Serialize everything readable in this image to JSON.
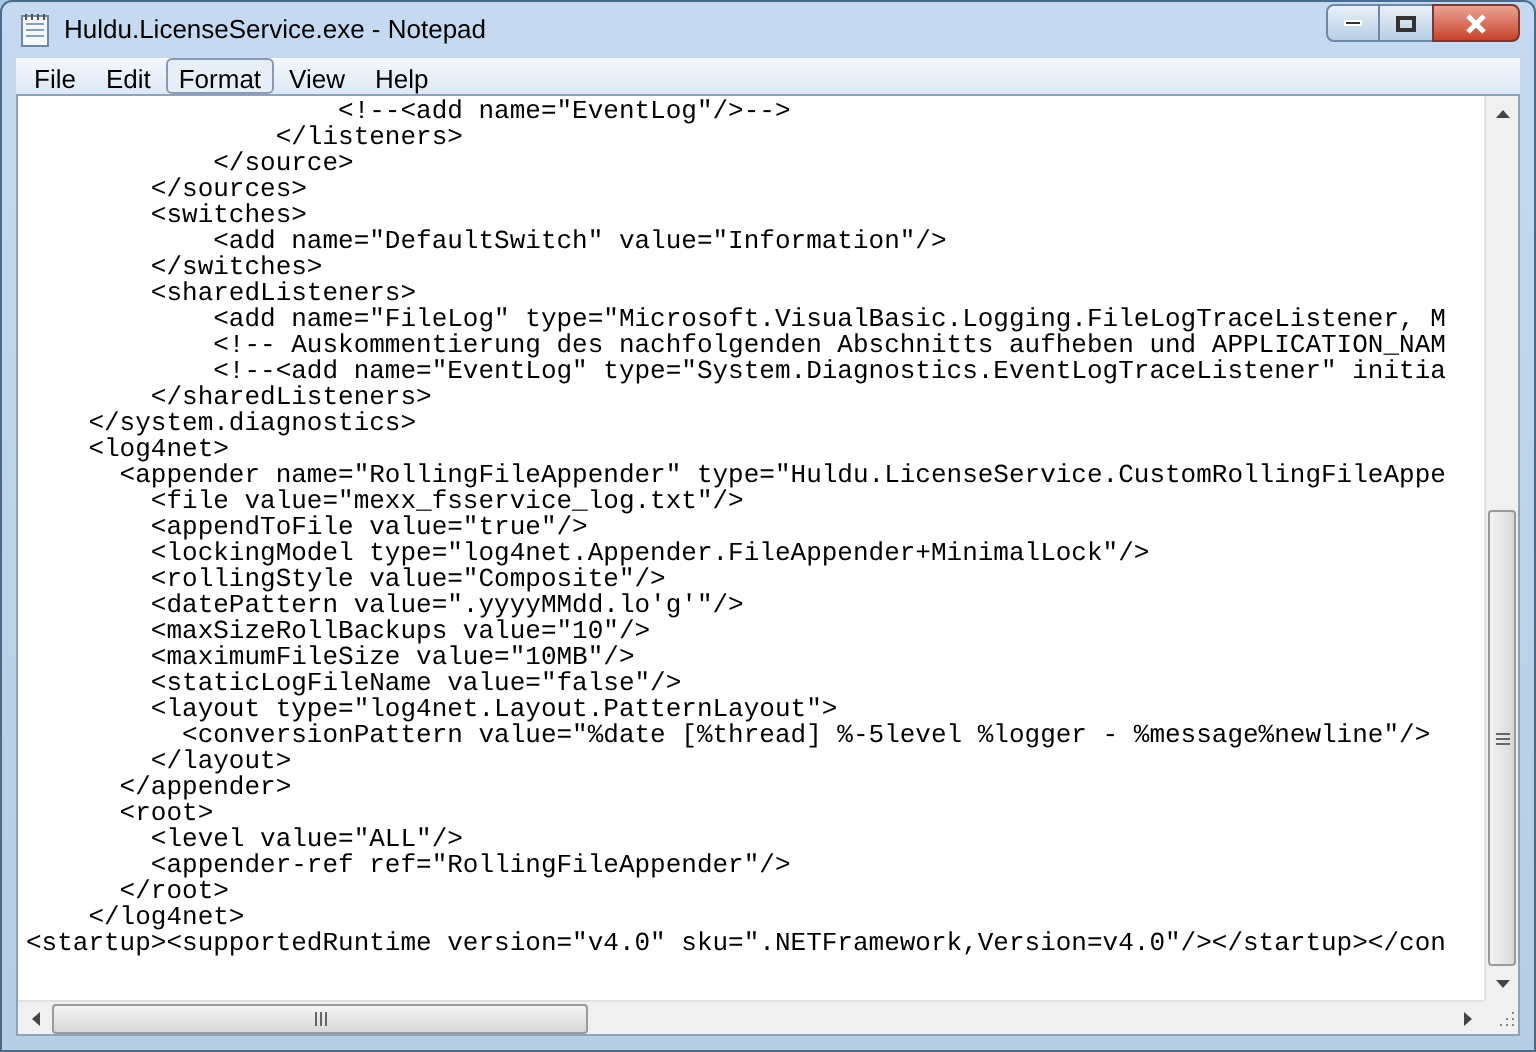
{
  "window": {
    "title": "Huldu.LicenseService.exe - Notepad"
  },
  "menu": [
    {
      "label": "File",
      "selected": false
    },
    {
      "label": "Edit",
      "selected": false
    },
    {
      "label": "Format",
      "selected": true
    },
    {
      "label": "View",
      "selected": false
    },
    {
      "label": "Help",
      "selected": false
    }
  ],
  "document": {
    "lines": [
      "                    <!--<add name=\"EventLog\"/>-->",
      "                </listeners>",
      "            </source>",
      "        </sources>",
      "        <switches>",
      "            <add name=\"DefaultSwitch\" value=\"Information\"/>",
      "        </switches>",
      "        <sharedListeners>",
      "            <add name=\"FileLog\" type=\"Microsoft.VisualBasic.Logging.FileLogTraceListener, M",
      "            <!-- Auskommentierung des nachfolgenden Abschnitts aufheben und APPLICATION_NAM",
      "            <!--<add name=\"EventLog\" type=\"System.Diagnostics.EventLogTraceListener\" initia",
      "        </sharedListeners>",
      "    </system.diagnostics>",
      "    <log4net>",
      "      <appender name=\"RollingFileAppender\" type=\"Huldu.LicenseService.CustomRollingFileAppe",
      "        <file value=\"mexx_fsservice_log.txt\"/>",
      "        <appendToFile value=\"true\"/>",
      "        <lockingModel type=\"log4net.Appender.FileAppender+MinimalLock\"/>",
      "        <rollingStyle value=\"Composite\"/>",
      "        <datePattern value=\".yyyyMMdd.lo'g'\"/>",
      "        <maxSizeRollBackups value=\"10\"/>",
      "        <maximumFileSize value=\"10MB\"/>",
      "        <staticLogFileName value=\"false\"/>",
      "        <layout type=\"log4net.Layout.PatternLayout\">",
      "          <conversionPattern value=\"%date [%thread] %-5level %logger - %message%newline\"/>",
      "        </layout>",
      "      </appender>",
      "      <root>",
      "        <level value=\"ALL\"/>",
      "        <appender-ref ref=\"RollingFileAppender\"/>",
      "      </root>",
      "    </log4net>",
      "<startup><supportedRuntime version=\"v4.0\" sku=\".NETFramework,Version=v4.0\"/></startup></con"
    ]
  }
}
